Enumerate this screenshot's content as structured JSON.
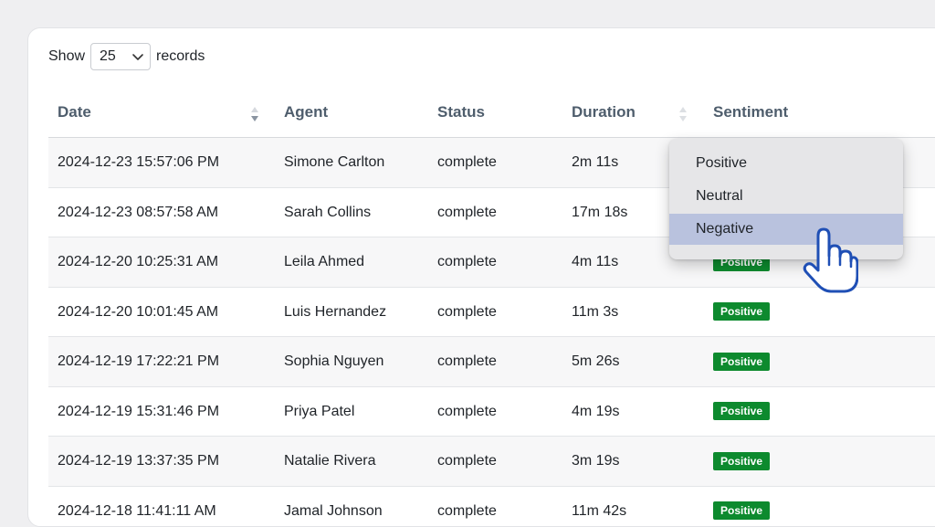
{
  "length_control": {
    "show_label": "Show",
    "selected_value": "25",
    "records_label": "records"
  },
  "columns": [
    "Date",
    "Agent",
    "Status",
    "Duration",
    "Sentiment"
  ],
  "rows": [
    {
      "date": "2024-12-23 15:57:06 PM",
      "agent": "Simone Carlton",
      "status": "complete",
      "duration": "2m 11s",
      "sentiment": ""
    },
    {
      "date": "2024-12-23 08:57:58 AM",
      "agent": "Sarah Collins",
      "status": "complete",
      "duration": "17m 18s",
      "sentiment": ""
    },
    {
      "date": "2024-12-20 10:25:31 AM",
      "agent": "Leila Ahmed",
      "status": "complete",
      "duration": "4m 11s",
      "sentiment": "Positive"
    },
    {
      "date": "2024-12-20 10:01:45 AM",
      "agent": "Luis Hernandez",
      "status": "complete",
      "duration": "11m 3s",
      "sentiment": "Positive"
    },
    {
      "date": "2024-12-19 17:22:21 PM",
      "agent": "Sophia Nguyen",
      "status": "complete",
      "duration": "5m 26s",
      "sentiment": "Positive"
    },
    {
      "date": "2024-12-19 15:31:46 PM",
      "agent": "Priya Patel",
      "status": "complete",
      "duration": "4m 19s",
      "sentiment": "Positive"
    },
    {
      "date": "2024-12-19 13:37:35 PM",
      "agent": "Natalie Rivera",
      "status": "complete",
      "duration": "3m 19s",
      "sentiment": "Positive"
    },
    {
      "date": "2024-12-18 11:41:11 AM",
      "agent": "Jamal Johnson",
      "status": "complete",
      "duration": "11m 42s",
      "sentiment": "Positive"
    }
  ],
  "sentiment_dropdown": {
    "options": [
      "Positive",
      "Neutral",
      "Negative"
    ],
    "highlighted": "Negative"
  },
  "colors": {
    "badge_positive": "#0d8a2e",
    "dropdown_highlight": "#b9c2de",
    "header_text": "#4e5d6c",
    "cursor_outline": "#1f4fb5"
  }
}
